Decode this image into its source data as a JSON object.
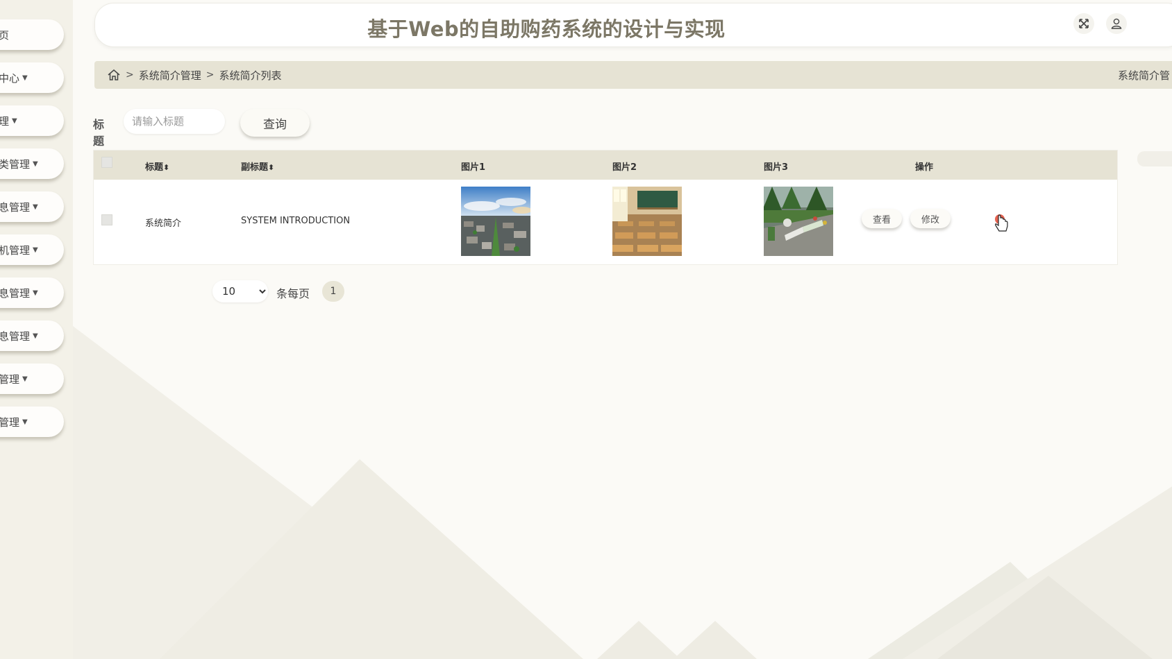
{
  "header": {
    "title": "基于Web的自助购药系统的设计与实现",
    "icons": [
      "fullscreen-icon",
      "user-icon"
    ]
  },
  "sidebar": {
    "items": [
      {
        "label": "页",
        "caret": false
      },
      {
        "label": "中心",
        "caret": true
      },
      {
        "label": "理",
        "caret": true
      },
      {
        "label": "类管理",
        "caret": true
      },
      {
        "label": "息管理",
        "caret": true
      },
      {
        "label": "机管理",
        "caret": true
      },
      {
        "label": "息管理",
        "caret": true
      },
      {
        "label": "息管理",
        "caret": true
      },
      {
        "label": "管理",
        "caret": true
      },
      {
        "label": "管理",
        "caret": true
      }
    ]
  },
  "breadcrumb": {
    "separator": ">",
    "items": [
      "系统简介管理",
      "系统简介列表"
    ],
    "right_text": "系统简介管"
  },
  "search": {
    "label": "标题",
    "placeholder": "请输入标题",
    "button": "查询"
  },
  "table": {
    "columns": {
      "title": "标题",
      "subtitle": "副标题",
      "image1": "图片1",
      "image2": "图片2",
      "image3": "图片3",
      "actions": "操作"
    },
    "sort_glyph": "⬍",
    "rows": [
      {
        "title": "系统简介",
        "subtitle": "SYSTEM INTRODUCTION",
        "images": [
          "town-aerial-photo",
          "classroom-photo",
          "campus-garden-photo"
        ],
        "view_label": "查看",
        "edit_label": "修改"
      }
    ]
  },
  "pagination": {
    "page_size": "10",
    "page_size_options": [
      "10"
    ],
    "per_page_label": "条每页",
    "current_page": "1"
  },
  "colors": {
    "accent": "#e6e3d4",
    "title": "#7c7766",
    "background": "#fbfaf6"
  }
}
